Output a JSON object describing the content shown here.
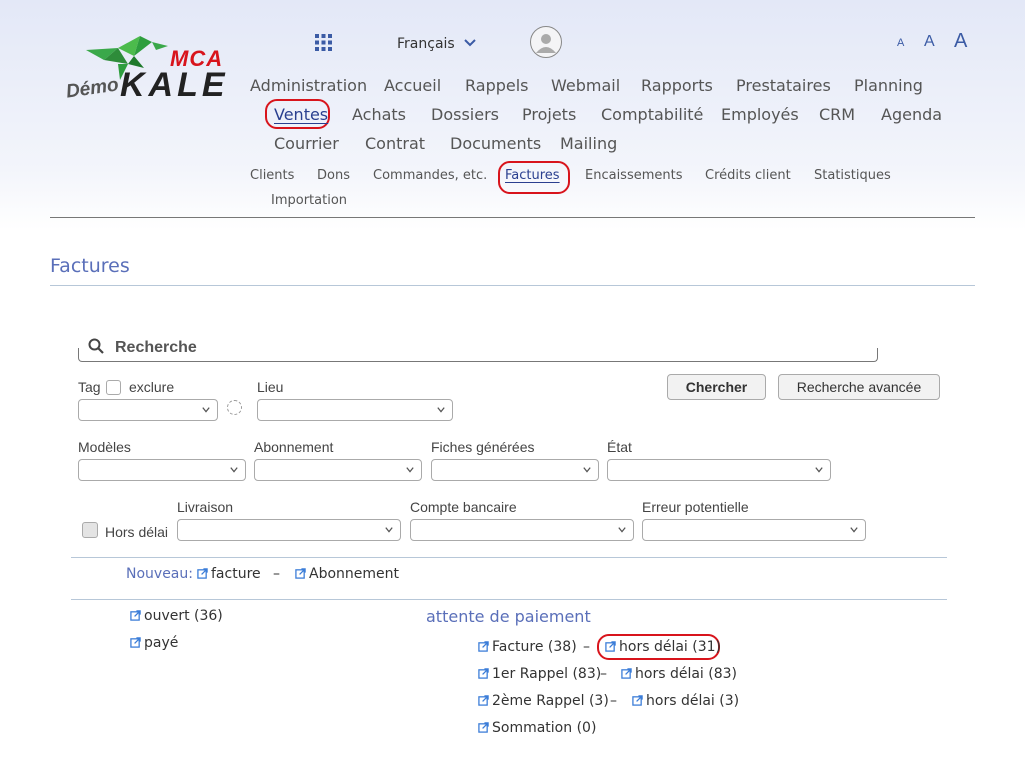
{
  "logo": {
    "mca": "MCA",
    "kale": "KALE",
    "demo": "Démo"
  },
  "top": {
    "language": "Français",
    "font_small": "A",
    "font_medium": "A",
    "font_large": "A"
  },
  "menu": {
    "row1": [
      "Administration",
      "Accueil",
      "Rappels",
      "Webmail",
      "Rapports",
      "Prestataires",
      "Planning"
    ],
    "row2": [
      "Ventes",
      "Achats",
      "Dossiers",
      "Projets",
      "Comptabilité",
      "Employés",
      "CRM",
      "Agenda"
    ],
    "row3": [
      "Courrier",
      "Contrat",
      "Documents",
      "Mailing"
    ]
  },
  "submenu": {
    "row1": [
      "Clients",
      "Dons",
      "Commandes, etc.",
      "Factures",
      "Encaissements",
      "Crédits client",
      "Statistiques"
    ],
    "row2": [
      "Importation"
    ]
  },
  "page": {
    "title": "Factures"
  },
  "search": {
    "placeholder": "Recherche"
  },
  "filters": {
    "tag": "Tag",
    "exclure": "exclure",
    "lieu": "Lieu",
    "chercher": "Chercher",
    "recherche_avancee": "Recherche avancée",
    "modeles": "Modèles",
    "abonnement": "Abonnement",
    "fiches_generees": "Fiches générées",
    "etat": "État",
    "livraison": "Livraison",
    "compte_bancaire": "Compte bancaire",
    "erreur_potentielle": "Erreur potentielle",
    "hors_delai": "Hors délai"
  },
  "nouveau": {
    "label": "Nouveau:",
    "facture": "facture",
    "sep": "–",
    "abonnement": "Abonnement"
  },
  "status": {
    "ouvert": "ouvert (36)",
    "paye": "payé",
    "attente_title": "attente de paiement",
    "facture": "Facture (38)",
    "facture_hors_delai": "hors délai (31)",
    "rappel1": "1er Rappel (83)",
    "rappel1_hors_delai": "hors délai (83)",
    "rappel2": "2ème Rappel (3)",
    "rappel2_hors_delai": "hors délai (3)",
    "sommation": "Sommation (0)",
    "sep": "–"
  },
  "colors": {
    "accent": "#5a6fb9",
    "active": "#2a3f8f",
    "highlight": "#d8141c",
    "logo_green": "#2e9e3e"
  }
}
